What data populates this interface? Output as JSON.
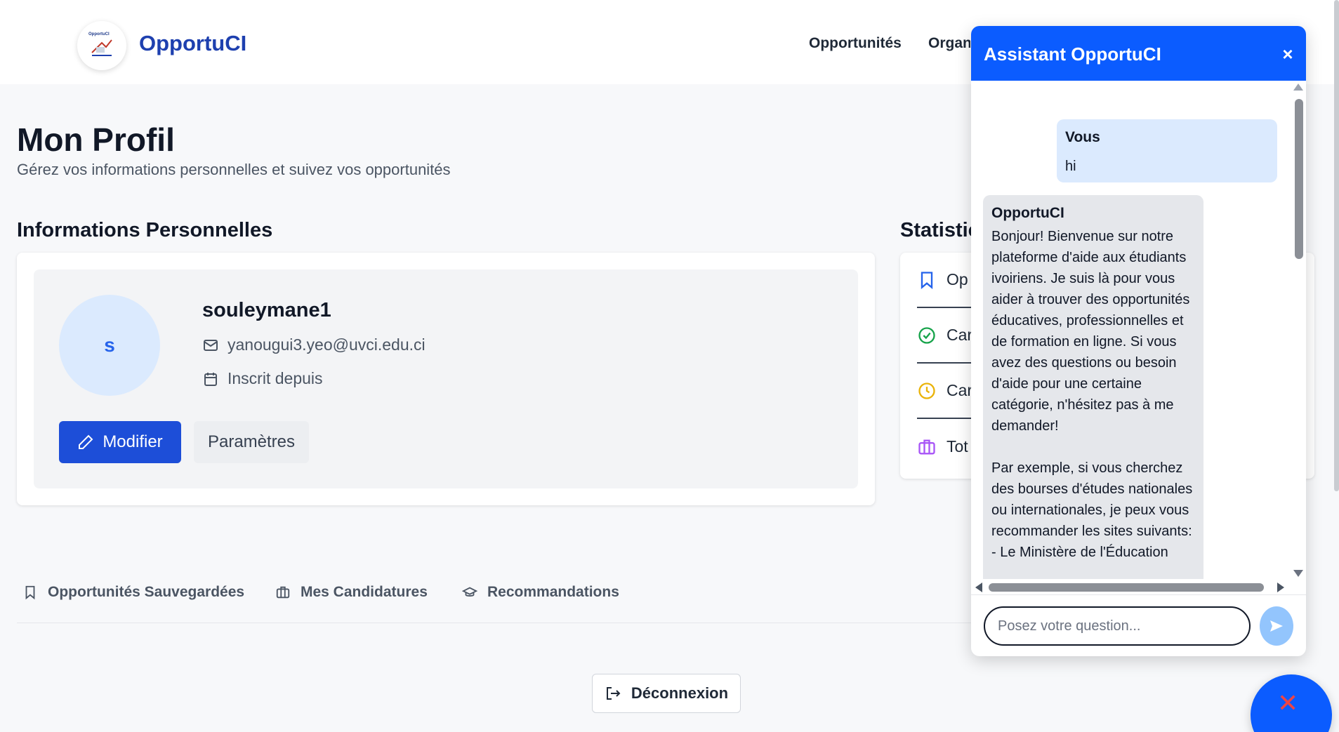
{
  "header": {
    "brand": "OpportuCI",
    "logo_text": "OpportuCI",
    "nav": [
      "Opportunités",
      "Organ"
    ]
  },
  "page": {
    "title": "Mon Profil",
    "subtitle": "Gérez vos informations personnelles et suivez vos opportunités"
  },
  "info": {
    "section_title": "Informations Personnelles",
    "avatar_initial": "s",
    "username": "souleymane1",
    "email": "yanougui3.yeo@uvci.edu.ci",
    "registered": "Inscrit depuis",
    "edit_label": "Modifier",
    "settings_label": "Paramètres"
  },
  "stats": {
    "section_title": "Statistic",
    "rows": [
      {
        "label": "Op",
        "icon": "bookmark-icon",
        "color": "#2563eb"
      },
      {
        "label": "Car",
        "icon": "check-circle-icon",
        "color": "#16a34a"
      },
      {
        "label": "Car",
        "icon": "clock-icon",
        "color": "#eab308"
      },
      {
        "label": "Tot",
        "icon": "briefcase-icon",
        "color": "#a855f7"
      }
    ]
  },
  "tabs": [
    {
      "label": "Opportunités Sauvegardées",
      "icon": "bookmark-icon"
    },
    {
      "label": "Mes Candidatures",
      "icon": "briefcase-icon"
    },
    {
      "label": "Recommandations",
      "icon": "graduation-cap-icon"
    }
  ],
  "logout_label": "Déconnexion",
  "chat": {
    "title": "Assistant OpportuCI",
    "close_symbol": "×",
    "user_message": {
      "sender": "Vous",
      "text": "hi"
    },
    "bot_message": {
      "sender": "OpportuCI",
      "text": "Bonjour! Bienvenue sur notre plateforme d'aide aux étudiants ivoiriens. Je suis là pour vous aider à trouver des opportunités éducatives, professionnelles et de formation en ligne. Si vous avez des questions ou besoin d'aide pour une certaine catégorie, n'hésitez pas à me demander!\n\nPar exemple, si vous cherchez des bourses d'études nationales ou internationales, je peux vous recommander les sites suivants:\n- Le Ministère de l'Éducation"
    },
    "input_placeholder": "Posez votre question...",
    "fab_symbol": "✕"
  },
  "colors": {
    "primary": "#0b5cff",
    "brand": "#1e40af",
    "edit_button": "#1d4ed8"
  }
}
